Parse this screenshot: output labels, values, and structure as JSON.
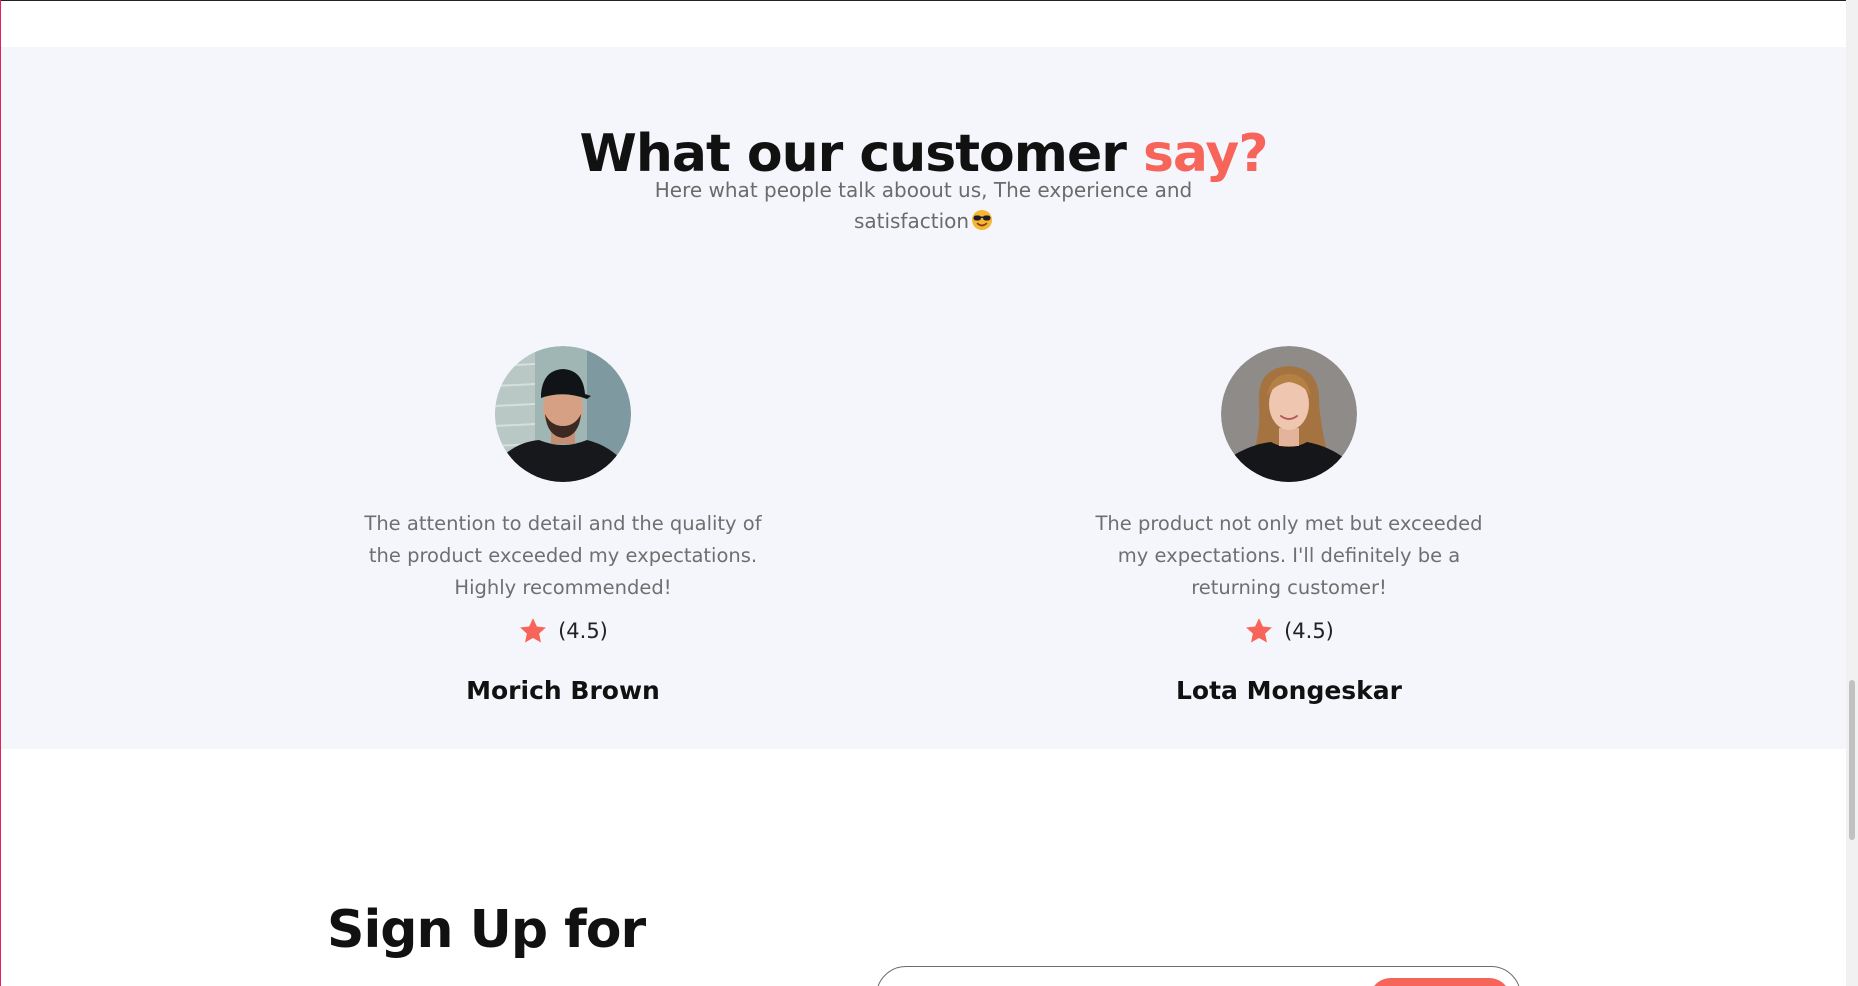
{
  "testimonials": {
    "title_main": "What our customer ",
    "title_accent": "say?",
    "subtitle": "Here what people talk aboout us, The experience and satisfaction",
    "subtitle_emoji": "sunglasses-emoji-icon",
    "items": [
      {
        "avatar": "man-in-black-cap-avatar",
        "quote": "The attention to detail and the quality of the product exceeded my expectations. Highly recommended!",
        "rating": "(4.5)",
        "name": "Morich Brown"
      },
      {
        "avatar": "blonde-woman-avatar",
        "quote": "The product not only met but exceeded my expectations. I'll definitely be a returning customer!",
        "rating": "(4.5)",
        "name": "Lota Mongeskar"
      }
    ]
  },
  "signup": {
    "title": "Sign Up for"
  },
  "colors": {
    "accent": "#f6645a",
    "section_bg": "#f5f6fc",
    "text_muted": "#6f6f6f"
  }
}
